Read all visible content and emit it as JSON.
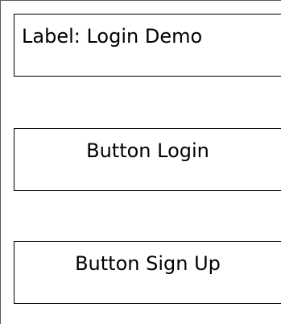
{
  "label": {
    "text": "Label: Login Demo"
  },
  "buttons": {
    "login_label": "Button Login",
    "signup_label": "Button Sign Up"
  }
}
